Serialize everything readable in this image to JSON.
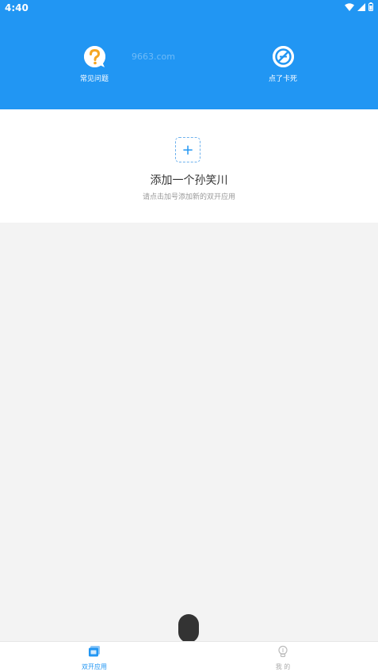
{
  "status_bar": {
    "time": "4:40"
  },
  "header": {
    "tools": [
      {
        "label": "常见问题",
        "icon": "question-icon"
      },
      {
        "label": "点了卡死",
        "icon": "no-entry-icon"
      }
    ],
    "watermark": "9663.com",
    "bg_color": "#2196f3"
  },
  "add_card": {
    "plus": "+",
    "title": "添加一个孙笑川",
    "subtitle": "请点击加号添加新的双开应用"
  },
  "bottom_nav": {
    "items": [
      {
        "label": "双开应用",
        "icon": "apps-icon",
        "active": true
      },
      {
        "label": "我 的",
        "icon": "lightbulb-icon",
        "active": false
      }
    ],
    "accent": "#2196f3"
  }
}
